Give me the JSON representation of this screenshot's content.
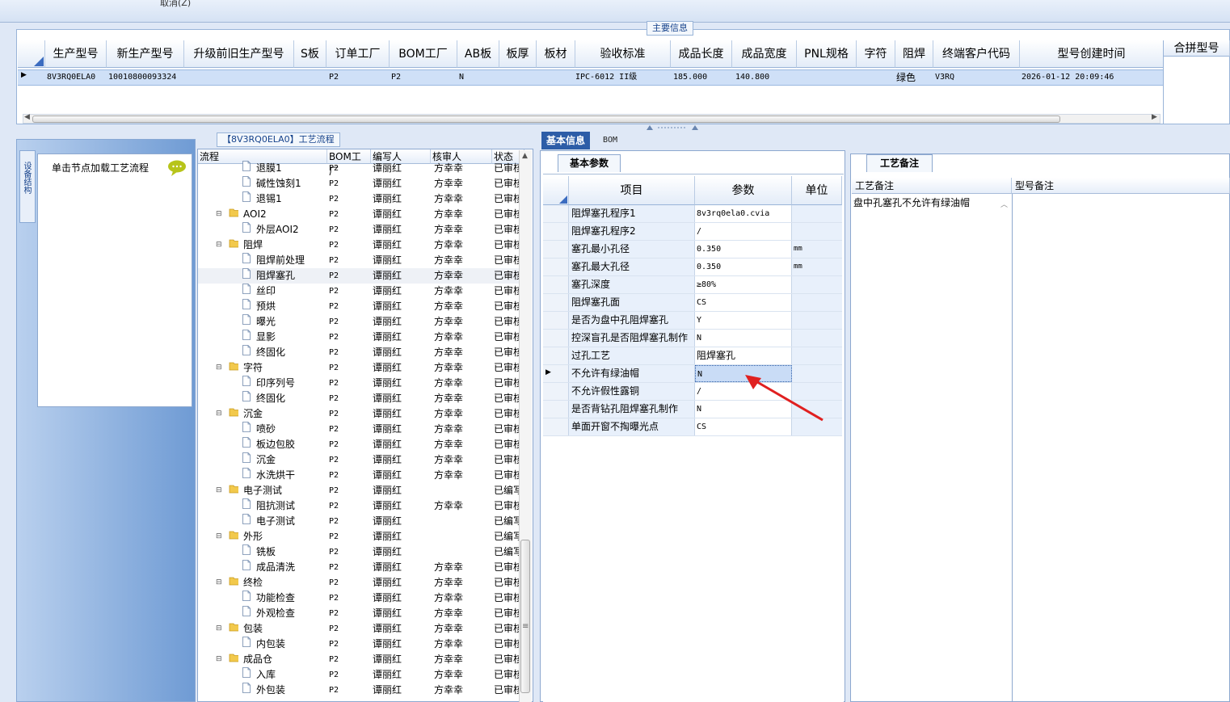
{
  "toolbar": {
    "cancel_label": "取消(Z)"
  },
  "main_info": {
    "caption": "主要信息",
    "columns": [
      "生产型号",
      "新生产型号",
      "升级前旧生产型号",
      "S板",
      "订单工厂",
      "BOM工厂",
      "AB板",
      "板厚",
      "板材",
      "验收标准",
      "成品长度",
      "成品宽度",
      "PNL规格",
      "字符",
      "阻焊",
      "终端客户代码",
      "型号创建时间",
      "合拼型号"
    ],
    "row": {
      "model": "8V3RQ0ELA0",
      "new_model": "10010800093324",
      "order_factory": "P2",
      "bom_factory": "P2",
      "ab_board": "N",
      "standard": "IPC-6012 II级",
      "length": "185.000",
      "width": "140.800",
      "solder_mask": "绿色",
      "customer_code": "V3RQ",
      "created": "2026-01-12 20:09:46"
    }
  },
  "left_panel": {
    "vertical_tab": "设备结构",
    "node_hint": "单击节点加载工艺流程",
    "hint_icon": "speech-bubble-icon"
  },
  "tree": {
    "caption": "【8V3RQ0ELA0】工艺流程",
    "headers": [
      "流程",
      "BOM工厂",
      "编写人",
      "核审人",
      "状态"
    ],
    "rows": [
      {
        "name": "退膜1",
        "level": 2,
        "factory": "P2",
        "writer": "谭丽红",
        "reviewer": "方幸幸",
        "status": "已审核"
      },
      {
        "name": "碱性蚀刻1",
        "level": 2,
        "factory": "P2",
        "writer": "谭丽红",
        "reviewer": "方幸幸",
        "status": "已审核"
      },
      {
        "name": "退锡1",
        "level": 2,
        "factory": "P2",
        "writer": "谭丽红",
        "reviewer": "方幸幸",
        "status": "已审核"
      },
      {
        "name": "AOI2",
        "level": 1,
        "factory": "P2",
        "writer": "谭丽红",
        "reviewer": "方幸幸",
        "status": "已审核"
      },
      {
        "name": "外层AOI2",
        "level": 2,
        "factory": "P2",
        "writer": "谭丽红",
        "reviewer": "方幸幸",
        "status": "已审核"
      },
      {
        "name": "阻焊",
        "level": 1,
        "factory": "P2",
        "writer": "谭丽红",
        "reviewer": "方幸幸",
        "status": "已审核"
      },
      {
        "name": "阻焊前处理",
        "level": 2,
        "factory": "P2",
        "writer": "谭丽红",
        "reviewer": "方幸幸",
        "status": "已审核"
      },
      {
        "name": "阻焊塞孔",
        "level": 2,
        "factory": "P2",
        "writer": "谭丽红",
        "reviewer": "方幸幸",
        "status": "已审核"
      },
      {
        "name": "丝印",
        "level": 2,
        "factory": "P2",
        "writer": "谭丽红",
        "reviewer": "方幸幸",
        "status": "已审核"
      },
      {
        "name": "预烘",
        "level": 2,
        "factory": "P2",
        "writer": "谭丽红",
        "reviewer": "方幸幸",
        "status": "已审核"
      },
      {
        "name": "曝光",
        "level": 2,
        "factory": "P2",
        "writer": "谭丽红",
        "reviewer": "方幸幸",
        "status": "已审核"
      },
      {
        "name": "显影",
        "level": 2,
        "factory": "P2",
        "writer": "谭丽红",
        "reviewer": "方幸幸",
        "status": "已审核"
      },
      {
        "name": "终固化",
        "level": 2,
        "factory": "P2",
        "writer": "谭丽红",
        "reviewer": "方幸幸",
        "status": "已审核"
      },
      {
        "name": "字符",
        "level": 1,
        "factory": "P2",
        "writer": "谭丽红",
        "reviewer": "方幸幸",
        "status": "已审核"
      },
      {
        "name": "印序列号",
        "level": 2,
        "factory": "P2",
        "writer": "谭丽红",
        "reviewer": "方幸幸",
        "status": "已审核"
      },
      {
        "name": "终固化",
        "level": 2,
        "factory": "P2",
        "writer": "谭丽红",
        "reviewer": "方幸幸",
        "status": "已审核"
      },
      {
        "name": "沉金",
        "level": 1,
        "factory": "P2",
        "writer": "谭丽红",
        "reviewer": "方幸幸",
        "status": "已审核"
      },
      {
        "name": "喷砂",
        "level": 2,
        "factory": "P2",
        "writer": "谭丽红",
        "reviewer": "方幸幸",
        "status": "已审核"
      },
      {
        "name": "板边包胶",
        "level": 2,
        "factory": "P2",
        "writer": "谭丽红",
        "reviewer": "方幸幸",
        "status": "已审核"
      },
      {
        "name": "沉金",
        "level": 2,
        "factory": "P2",
        "writer": "谭丽红",
        "reviewer": "方幸幸",
        "status": "已审核"
      },
      {
        "name": "水洗烘干",
        "level": 2,
        "factory": "P2",
        "writer": "谭丽红",
        "reviewer": "方幸幸",
        "status": "已审核"
      },
      {
        "name": "电子测试",
        "level": 1,
        "factory": "P2",
        "writer": "谭丽红",
        "reviewer": "",
        "status": "已编写"
      },
      {
        "name": "阻抗测试",
        "level": 2,
        "factory": "P2",
        "writer": "谭丽红",
        "reviewer": "方幸幸",
        "status": "已审核"
      },
      {
        "name": "电子测试",
        "level": 2,
        "factory": "P2",
        "writer": "谭丽红",
        "reviewer": "",
        "status": "已编写"
      },
      {
        "name": "外形",
        "level": 1,
        "factory": "P2",
        "writer": "谭丽红",
        "reviewer": "",
        "status": "已编写"
      },
      {
        "name": "铣板",
        "level": 2,
        "factory": "P2",
        "writer": "谭丽红",
        "reviewer": "",
        "status": "已编写"
      },
      {
        "name": "成品清洗",
        "level": 2,
        "factory": "P2",
        "writer": "谭丽红",
        "reviewer": "方幸幸",
        "status": "已审核"
      },
      {
        "name": "终检",
        "level": 1,
        "factory": "P2",
        "writer": "谭丽红",
        "reviewer": "方幸幸",
        "status": "已审核"
      },
      {
        "name": "功能检查",
        "level": 2,
        "factory": "P2",
        "writer": "谭丽红",
        "reviewer": "方幸幸",
        "status": "已审核"
      },
      {
        "name": "外观检查",
        "level": 2,
        "factory": "P2",
        "writer": "谭丽红",
        "reviewer": "方幸幸",
        "status": "已审核"
      },
      {
        "name": "包装",
        "level": 1,
        "factory": "P2",
        "writer": "谭丽红",
        "reviewer": "方幸幸",
        "status": "已审核"
      },
      {
        "name": "内包装",
        "level": 2,
        "factory": "P2",
        "writer": "谭丽红",
        "reviewer": "方幸幸",
        "status": "已审核"
      },
      {
        "name": "成品仓",
        "level": 1,
        "factory": "P2",
        "writer": "谭丽红",
        "reviewer": "方幸幸",
        "status": "已审核"
      },
      {
        "name": "入库",
        "level": 2,
        "factory": "P2",
        "writer": "谭丽红",
        "reviewer": "方幸幸",
        "status": "已审核"
      },
      {
        "name": "外包装",
        "level": 2,
        "factory": "P2",
        "writer": "谭丽红",
        "reviewer": "方幸幸",
        "status": "已审核"
      }
    ]
  },
  "tabs": {
    "basic_info": "基本信息",
    "bom": "BOM"
  },
  "basic_params": {
    "tab_label": "基本参数",
    "headers": [
      "项目",
      "参数",
      "单位"
    ],
    "rows": [
      {
        "item": "阻焊塞孔程序1",
        "value": "8v3rq0ela0.cvia",
        "unit": ""
      },
      {
        "item": "阻焊塞孔程序2",
        "value": "/",
        "unit": ""
      },
      {
        "item": "塞孔最小孔径",
        "value": "0.350",
        "unit": "mm"
      },
      {
        "item": "塞孔最大孔径",
        "value": "0.350",
        "unit": "mm"
      },
      {
        "item": "塞孔深度",
        "value": "≥80%",
        "unit": ""
      },
      {
        "item": "阻焊塞孔面",
        "value": "CS",
        "unit": ""
      },
      {
        "item": "是否为盘中孔阻焊塞孔",
        "value": "Y",
        "unit": ""
      },
      {
        "item": "控深盲孔是否阻焊塞孔制作",
        "value": "N",
        "unit": ""
      },
      {
        "item": "过孔工艺",
        "value": "阻焊塞孔",
        "unit": ""
      },
      {
        "item": "不允许有绿油帽",
        "value": "N",
        "unit": "",
        "selected": true
      },
      {
        "item": "不允许假性露铜",
        "value": "/",
        "unit": ""
      },
      {
        "item": "是否背钻孔阻焊塞孔制作",
        "value": "N",
        "unit": ""
      },
      {
        "item": "单面开窗不掏曝光点",
        "value": "CS",
        "unit": ""
      }
    ]
  },
  "process_notes": {
    "tab_label": "工艺备注",
    "col_process_note": "工艺备注",
    "col_model_note": "型号备注",
    "note_text": "盘中孔塞孔不允许有绿油帽"
  },
  "colors": {
    "accent": "#2d5da7",
    "selection": "#cfe0f7",
    "annotation_arrow": "#e02020",
    "folder": "#f2c94c"
  }
}
